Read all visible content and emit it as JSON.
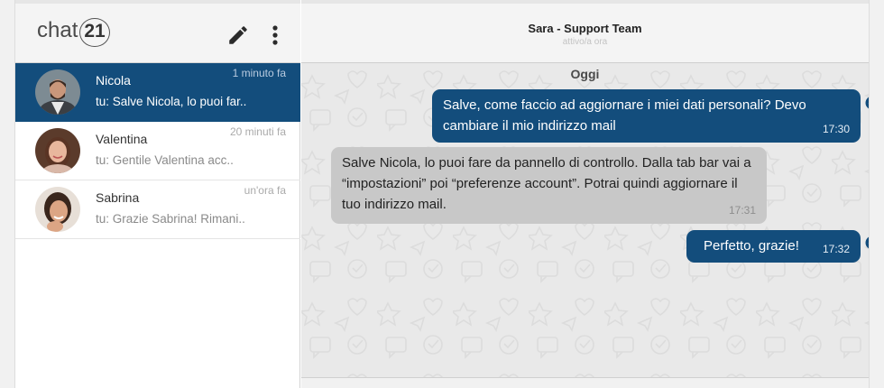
{
  "app": {
    "logo_text": "chat",
    "logo_number": "21",
    "colors": {
      "accent": "#134d7c",
      "incoming_bubble": "#c8c8c8",
      "chat_background": "#e9e9e9"
    }
  },
  "sidebar": {
    "header_icons": [
      "pencil-icon",
      "more-vert-icon"
    ],
    "conversations": [
      {
        "name": "Nicola",
        "time": "1 minuto fa",
        "last_message": "tu: Salve Nicola, lo puoi far..",
        "active": true
      },
      {
        "name": "Valentina",
        "time": "20 minuti fa",
        "last_message": "tu: Gentile Valentina acc..",
        "active": false
      },
      {
        "name": "Sabrina",
        "time": "un'ora fa",
        "last_message": "tu: Grazie Sabrina! Rimani..",
        "active": false
      }
    ]
  },
  "chat": {
    "title": "Sara - Support Team",
    "status": "attivo/a ora",
    "day_label": "Oggi",
    "messages": [
      {
        "direction": "out",
        "text": "Salve, come faccio ad aggiornare i miei dati personali? Devo cambiare il mio indirizzo mail",
        "time": "17:30",
        "read": true
      },
      {
        "direction": "in",
        "text": "Salve Nicola, lo puoi fare da pannello di controllo. Dalla tab bar vai a “impostazioni” poi “preferenze account”.  Potrai quindi aggiornare il tuo indirizzo mail.",
        "time": "17:31"
      },
      {
        "direction": "out",
        "text": "Perfetto, grazie!",
        "time": "17:32",
        "read": true
      }
    ]
  }
}
